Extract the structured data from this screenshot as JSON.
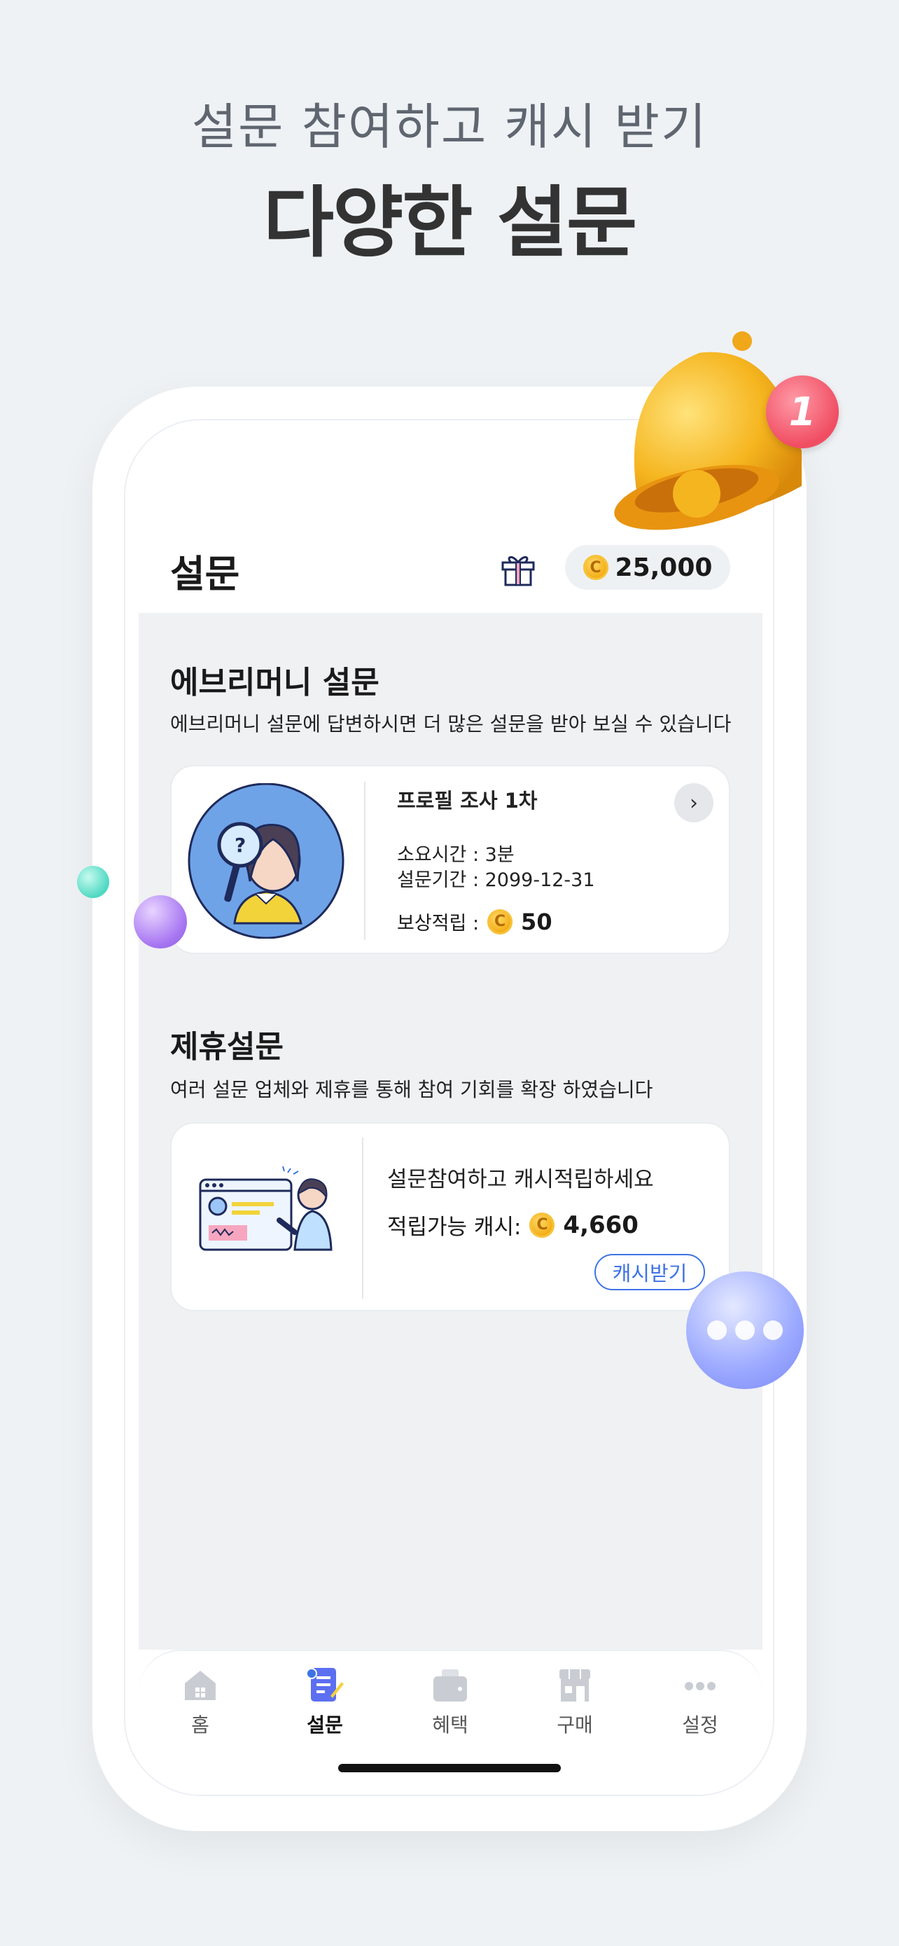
{
  "promo": {
    "subtitle": "설문 참여하고 캐시 받기",
    "title": "다양한 설문"
  },
  "header": {
    "title": "설문",
    "gift_icon": "gift-icon",
    "cash_balance": "25,000",
    "coin_symbol": "C"
  },
  "every_survey": {
    "title": "에브리머니 설문",
    "description": "에브리머니 설문에 답변하시면 더 많은 설문을 받아 보실 수 있습니다",
    "card": {
      "name": "프로필 조사 1차",
      "duration": "소요시간 : 3분",
      "period": "설문기간 : 2099-12-31",
      "reward_label": "보상적립 :",
      "reward_value": "50",
      "arrow": "›"
    }
  },
  "partner_survey": {
    "title": "제휴설문",
    "description": "여러 설문 업체와 제휴를 통해 참여 기회를 확장 하였습니다",
    "card": {
      "headline": "설문참여하고 캐시적립하세요",
      "available_label": "적립가능 캐시:",
      "available_value": "4,660",
      "button_label": "캐시받기"
    }
  },
  "badge": {
    "count": "1"
  },
  "nav": {
    "items": [
      {
        "label": "홈",
        "icon": "home-icon"
      },
      {
        "label": "설문",
        "icon": "survey-icon",
        "active": true
      },
      {
        "label": "혜택",
        "icon": "wallet-icon"
      },
      {
        "label": "구매",
        "icon": "store-icon"
      },
      {
        "label": "설정",
        "icon": "more-icon"
      }
    ]
  },
  "colors": {
    "background": "#eff2f5",
    "accent_blue": "#3e73e6",
    "coin_gold": "#f2a90f",
    "badge_red": "#f04d62"
  }
}
